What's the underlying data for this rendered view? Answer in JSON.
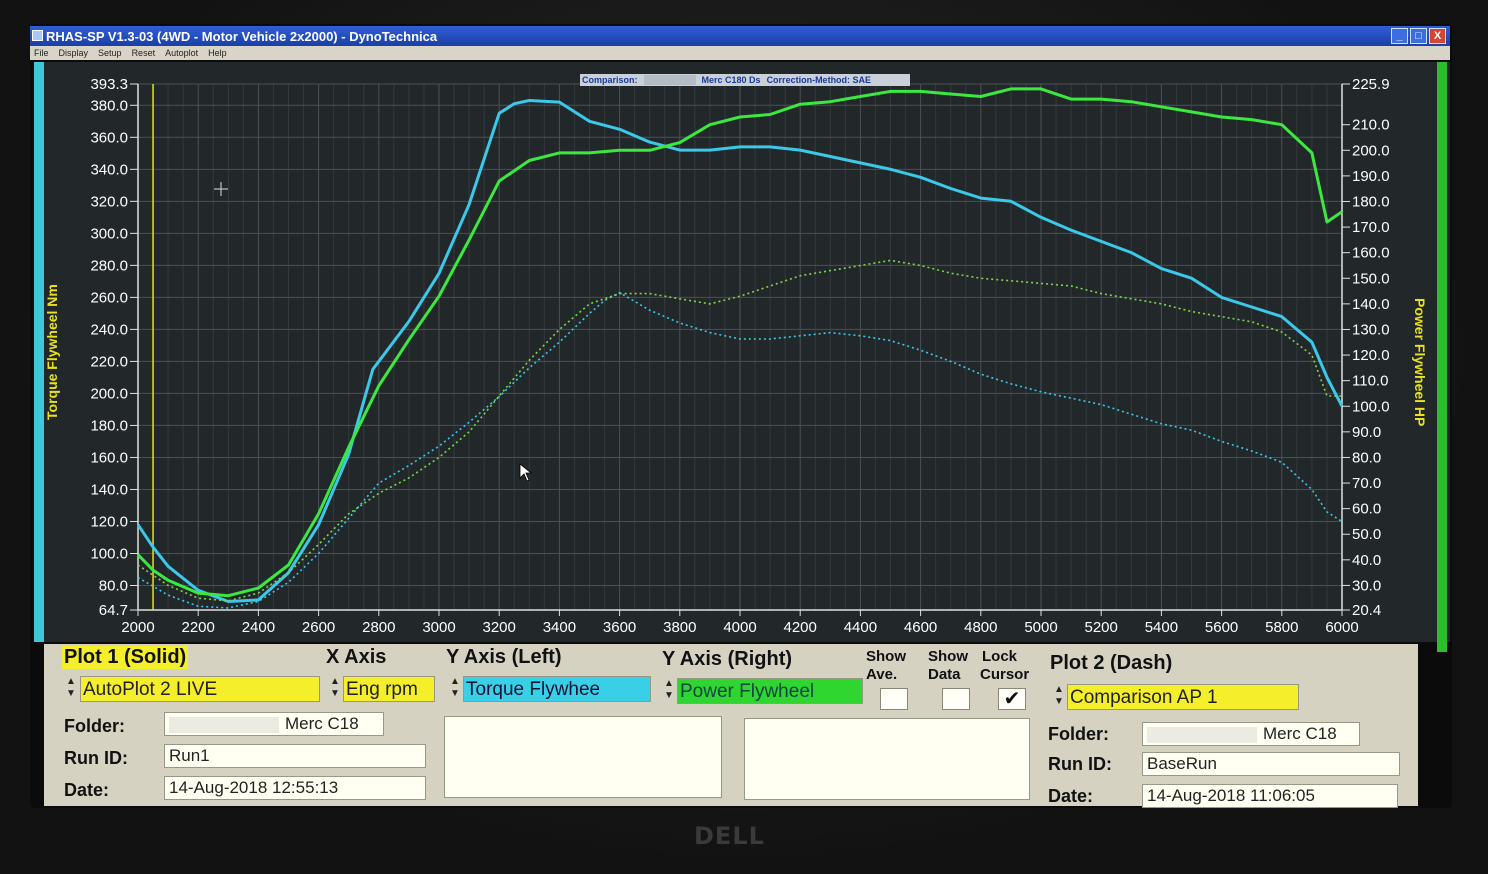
{
  "window": {
    "title": "RHAS-SP V1.3-03  (4WD - Motor Vehicle 2x2000) - DynoTechnica",
    "buttons": {
      "minimize": "_",
      "maximize": "□",
      "close": "X"
    }
  },
  "menu": [
    "File",
    "Display",
    "Setup",
    "Reset",
    "Autoplot",
    "Help"
  ],
  "comparison_bar": {
    "label": "Comparison:",
    "vehicle": "Merc C180 Ds",
    "correction": "Correction-Method: SAE"
  },
  "axis_labels": {
    "left": "Torque Flywheel Nm",
    "right": "Power Flywheel HP"
  },
  "chart_data": {
    "type": "line",
    "xlabel": "",
    "x_ticks": [
      2000,
      2200,
      2400,
      2600,
      2800,
      3000,
      3200,
      3400,
      3600,
      3800,
      4000,
      4200,
      4400,
      4600,
      4800,
      5000,
      5200,
      5400,
      5600,
      5800,
      6000
    ],
    "xlim": [
      2000,
      6000
    ],
    "y_left_label": "Torque Flywheel Nm",
    "y_left_lim": [
      64.7,
      393.3
    ],
    "y_left_ticks": [
      "393.3",
      "380.0",
      "360.0",
      "340.0",
      "320.0",
      "300.0",
      "280.0",
      "260.0",
      "240.0",
      "220.0",
      "200.0",
      "180.0",
      "160.0",
      "140.0",
      "120.0",
      "100.0",
      "80.0",
      "64.7"
    ],
    "y_right_label": "Power Flywheel HP",
    "y_right_lim": [
      20.4,
      225.9
    ],
    "y_right_ticks": [
      "225.9",
      "210.0",
      "200.0",
      "190.0",
      "180.0",
      "170.0",
      "160.0",
      "150.0",
      "140.0",
      "130.0",
      "120.0",
      "110.0",
      "100.0",
      "90.0",
      "80.0",
      "70.0",
      "60.0",
      "50.0",
      "40.0",
      "30.0",
      "20.4"
    ],
    "grid": true,
    "cursor_rpm": 2050,
    "series": [
      {
        "axis": "left",
        "style": "solid",
        "color": "#3cc8e8",
        "x": [
          2000,
          2050,
          2100,
          2200,
          2300,
          2400,
          2500,
          2600,
          2700,
          2780,
          2900,
          3000,
          3100,
          3200,
          3250,
          3300,
          3400,
          3500,
          3600,
          3700,
          3800,
          3900,
          4000,
          4100,
          4200,
          4300,
          4400,
          4500,
          4600,
          4700,
          4800,
          4900,
          5000,
          5100,
          5200,
          5300,
          5400,
          5500,
          5600,
          5700,
          5800,
          5900,
          5950,
          6000
        ],
        "y": [
          118,
          104,
          92,
          77,
          70,
          71,
          88,
          118,
          162,
          215,
          245,
          275,
          318,
          375,
          381,
          383,
          382,
          370,
          365,
          357,
          352,
          352,
          354,
          354,
          352,
          348,
          344,
          340,
          335,
          328,
          322,
          320,
          310,
          302,
          295,
          288,
          278,
          272,
          260,
          254,
          248,
          232,
          210,
          192
        ]
      },
      {
        "axis": "right",
        "style": "solid",
        "color": "#3ce840",
        "x": [
          2000,
          2050,
          2100,
          2200,
          2300,
          2400,
          2500,
          2600,
          2700,
          2800,
          2900,
          3000,
          3100,
          3200,
          3300,
          3400,
          3500,
          3600,
          3700,
          3800,
          3900,
          4000,
          4100,
          4200,
          4300,
          4400,
          4500,
          4600,
          4700,
          4800,
          4900,
          5000,
          5100,
          5200,
          5300,
          5400,
          5500,
          5600,
          5700,
          5800,
          5900,
          5950,
          6000
        ],
        "y": [
          42,
          36,
          32,
          27,
          26,
          29,
          38,
          58,
          84,
          108,
          126,
          143,
          165,
          188,
          196,
          199,
          199,
          200,
          200,
          203,
          210,
          213,
          214,
          218,
          219,
          221,
          223,
          223,
          222,
          221,
          224,
          224,
          220,
          220,
          219,
          217,
          215,
          213,
          212,
          210,
          199,
          172,
          176
        ]
      },
      {
        "axis": "left",
        "style": "dash",
        "color": "#3cc8e8",
        "x": [
          2000,
          2100,
          2200,
          2300,
          2400,
          2500,
          2600,
          2700,
          2800,
          2900,
          3000,
          3100,
          3200,
          3300,
          3400,
          3500,
          3550,
          3600,
          3700,
          3800,
          3900,
          4000,
          4100,
          4200,
          4300,
          4400,
          4500,
          4600,
          4700,
          4800,
          4900,
          5000,
          5100,
          5200,
          5300,
          5400,
          5500,
          5600,
          5700,
          5800,
          5900,
          5950,
          6000
        ],
        "y": [
          85,
          74,
          67,
          66,
          70,
          82,
          100,
          122,
          144,
          155,
          167,
          182,
          198,
          216,
          232,
          250,
          258,
          263,
          252,
          244,
          238,
          234,
          234,
          236,
          238,
          236,
          233,
          227,
          220,
          212,
          206,
          201,
          197,
          193,
          187,
          181,
          177,
          170,
          164,
          157,
          140,
          126,
          120
        ]
      },
      {
        "axis": "right",
        "style": "dash",
        "color": "#7ed84a",
        "x": [
          2000,
          2100,
          2200,
          2300,
          2400,
          2500,
          2600,
          2700,
          2800,
          2900,
          3000,
          3100,
          3200,
          3300,
          3400,
          3500,
          3600,
          3700,
          3800,
          3900,
          4000,
          4100,
          4200,
          4300,
          4400,
          4500,
          4600,
          4700,
          4800,
          4900,
          5000,
          5100,
          5200,
          5300,
          5400,
          5500,
          5600,
          5700,
          5800,
          5900,
          5950,
          6000
        ],
        "y": [
          38,
          30,
          25,
          24,
          27,
          35,
          46,
          58,
          66,
          72,
          80,
          90,
          104,
          118,
          130,
          140,
          144,
          144,
          142,
          140,
          143,
          147,
          151,
          153,
          155,
          157,
          155,
          152,
          150,
          149,
          148,
          147,
          144,
          142,
          140,
          137,
          135,
          133,
          129,
          120,
          104,
          104
        ]
      }
    ]
  },
  "panel": {
    "plot1": {
      "header": "Plot 1 (Solid)",
      "source": "AutoPlot 2 LIVE",
      "folder_label": "Folder:",
      "folder_value": "Merc C18",
      "run_label": "Run ID:",
      "run_value": "Run1",
      "date_label": "Date:",
      "date_value": "14-Aug-2018  12:55:13"
    },
    "x_axis": {
      "header": "X Axis",
      "value": "Eng rpm"
    },
    "y_left": {
      "header": "Y Axis (Left)",
      "value": "Torque Flywhee"
    },
    "y_right": {
      "header": "Y Axis (Right)",
      "value": "Power Flywheel"
    },
    "show_ave": {
      "line1": "Show",
      "line2": "Ave.",
      "checked": false
    },
    "show_data": {
      "line1": "Show",
      "line2": "Data",
      "checked": false
    },
    "lock_cursor": {
      "line1": "Lock",
      "line2": "Cursor",
      "checked": true,
      "mark": "✔"
    },
    "plot2": {
      "header": "Plot 2 (Dash)",
      "source": "Comparison AP 1",
      "folder_label": "Folder:",
      "folder_value": "Merc C18",
      "run_label": "Run ID:",
      "run_value": "BaseRun",
      "date_label": "Date:",
      "date_value": "14-Aug-2018  11:06:05"
    }
  },
  "bezel_logo": "DELL"
}
